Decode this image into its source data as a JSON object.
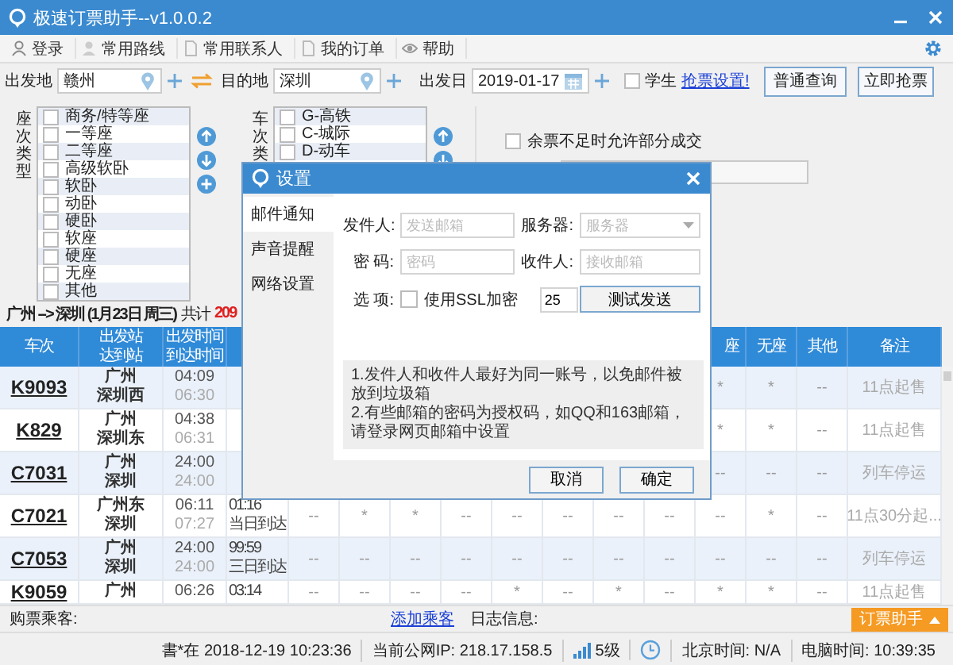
{
  "window": {
    "title": "极速订票助手--v1.0.0.2"
  },
  "toolbar": [
    {
      "label": "登录"
    },
    {
      "label": "常用路线"
    },
    {
      "label": "常用联系人"
    },
    {
      "label": "我的订单"
    },
    {
      "label": "帮助"
    }
  ],
  "query": {
    "from_label": "出发地",
    "from": "赣州",
    "to_label": "目的地",
    "to": "深圳",
    "date_label": "出发日",
    "date": "2019-01-17",
    "student": {
      "label": "学生",
      "checked": false
    },
    "grab_settings_link": "抢票设置!",
    "buttons": [
      "普通查询",
      "立即抢票"
    ]
  },
  "seat_types": {
    "label": "座次类型",
    "items": [
      {
        "label": "商务/特等座",
        "checked": false
      },
      {
        "label": "一等座",
        "checked": false
      },
      {
        "label": "二等座",
        "checked": false
      },
      {
        "label": "高级软卧",
        "checked": false
      },
      {
        "label": "软卧",
        "checked": false
      },
      {
        "label": "动卧",
        "checked": false
      },
      {
        "label": "硬卧",
        "checked": false
      },
      {
        "label": "软座",
        "checked": false
      },
      {
        "label": "硬座",
        "checked": false
      },
      {
        "label": "无座",
        "checked": false
      },
      {
        "label": "其他",
        "checked": false
      }
    ]
  },
  "train_types": {
    "label": "车次类",
    "items": [
      {
        "label": "G-高铁",
        "checked": false
      },
      {
        "label": "C-城际",
        "checked": false
      },
      {
        "label": "D-动车",
        "checked": false
      }
    ]
  },
  "options": {
    "partial_deal": {
      "label": "余票不足时允许部分成交",
      "checked": false
    }
  },
  "route_summary": {
    "route": "广州 --> 深圳 (1月23日 周三)",
    "total_label": "共计",
    "count": "209"
  },
  "table": {
    "columns_left": [
      [
        "车次"
      ],
      [
        "出发站",
        "达到站"
      ],
      [
        "出发时间",
        "到达时间"
      ]
    ],
    "seat_columns": [
      "座",
      "无座",
      "其他"
    ],
    "remark_column": "备注",
    "rows": [
      {
        "train": "K9093",
        "stations": [
          "广州",
          "深圳西"
        ],
        "times": [
          "04:09",
          "06:30"
        ],
        "seats": [
          "*",
          "*",
          "--"
        ],
        "remark": "11点起售"
      },
      {
        "train": "K829",
        "stations": [
          "广州",
          "深圳东"
        ],
        "times": [
          "04:38",
          "06:31"
        ],
        "seats": [
          "*",
          "*",
          "--"
        ],
        "remark": "11点起售"
      },
      {
        "train": "C7031",
        "stations": [
          "广州",
          "深圳"
        ],
        "times": [
          "24:00",
          "24:00"
        ],
        "seats": [
          "--",
          "--",
          "--"
        ],
        "remark": "列车停运"
      },
      {
        "train": "C7021",
        "stations": [
          "广州东",
          "深圳"
        ],
        "times": [
          "06:11",
          "07:27"
        ],
        "duration": [
          "01:16",
          "当日到达"
        ],
        "seats": [
          "--",
          "*",
          "*",
          "--",
          "--",
          "--",
          "--",
          "--",
          "--",
          "*",
          "--"
        ],
        "remark": "11点30分起..."
      },
      {
        "train": "C7053",
        "stations": [
          "广州",
          "深圳"
        ],
        "times": [
          "24:00",
          "24:00"
        ],
        "duration": [
          "99:59",
          "三日到达"
        ],
        "seats": [
          "--",
          "--",
          "--",
          "--",
          "--",
          "--",
          "--",
          "--",
          "--",
          "--",
          "--"
        ],
        "remark": "列车停运"
      },
      {
        "train": "K9059",
        "stations": [
          "广州"
        ],
        "times": [
          "06:26"
        ],
        "duration": [
          "03:14"
        ],
        "seats": [
          "--",
          "--",
          "--",
          "--",
          "*",
          "--",
          "*",
          "--",
          "*",
          "*",
          "--"
        ],
        "remark": "11点起售"
      }
    ]
  },
  "passengers": {
    "label": "购票乘客:",
    "add_link": "添加乘客"
  },
  "log": {
    "label": "日志信息:"
  },
  "helper_button": "订票助手",
  "status_bar": {
    "updated": "書*在 2018-12-19 10:23:36",
    "ip": "当前公网IP: 218.17.158.5",
    "signal": "5级",
    "beijing_time": "北京时间: N/A",
    "pc_time": "电脑时间: 10:39:35"
  },
  "dialog": {
    "title": "设置",
    "nav": [
      {
        "label": "邮件通知",
        "selected": true
      },
      {
        "label": "声音提醒",
        "selected": false
      },
      {
        "label": "网络设置",
        "selected": false
      }
    ],
    "sender_label": "发件人:",
    "sender_placeholder": "发送邮箱",
    "server_label": "服务器:",
    "server_placeholder": "服务器",
    "password_label": "密 码:",
    "password_placeholder": "密码",
    "recipient_label": "收件人:",
    "recipient_placeholder": "接收邮箱",
    "options_label": "选 项:",
    "ssl": {
      "label": "使用SSL加密",
      "checked": false
    },
    "port": "25",
    "test_button": "测试发送",
    "notes": [
      "1.发件人和收件人最好为同一账号，以免邮件被放到垃圾箱",
      "2.有些邮箱的密码为授权码，如QQ和163邮箱，请登录网页邮箱中设置"
    ],
    "buttons": [
      "取消",
      "确定"
    ]
  }
}
